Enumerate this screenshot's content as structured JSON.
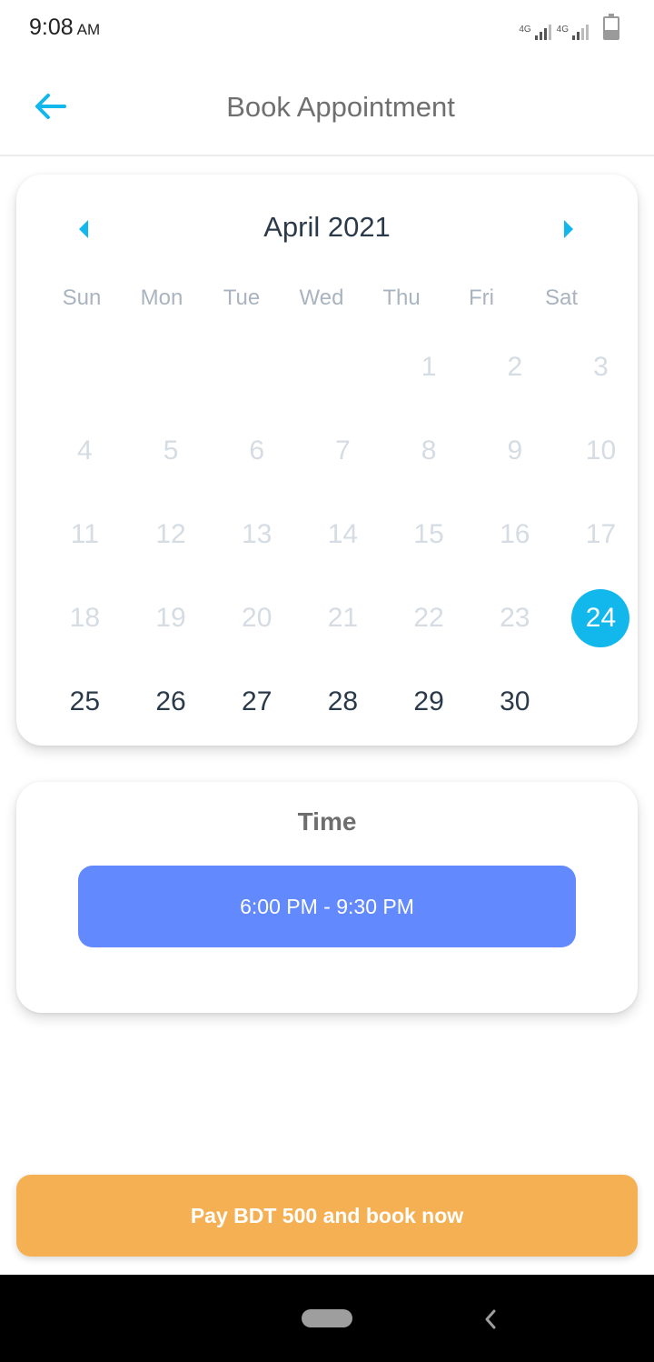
{
  "status_bar": {
    "time": "9:08",
    "ampm": "AM",
    "network_1": "4G",
    "network_2": "4G"
  },
  "app_bar": {
    "title": "Book Appointment",
    "back_icon": "arrow-left-icon",
    "accent_color": "#12b8ec"
  },
  "calendar": {
    "month_label": "April 2021",
    "prev_icon": "caret-left-icon",
    "next_icon": "caret-right-icon",
    "weekdays": [
      "Sun",
      "Mon",
      "Tue",
      "Wed",
      "Thu",
      "Fri",
      "Sat"
    ],
    "days": [
      {
        "label": "",
        "state": "empty"
      },
      {
        "label": "",
        "state": "empty"
      },
      {
        "label": "",
        "state": "empty"
      },
      {
        "label": "",
        "state": "empty"
      },
      {
        "label": "1",
        "state": "disabled"
      },
      {
        "label": "2",
        "state": "disabled"
      },
      {
        "label": "3",
        "state": "disabled"
      },
      {
        "label": "4",
        "state": "disabled"
      },
      {
        "label": "5",
        "state": "disabled"
      },
      {
        "label": "6",
        "state": "disabled"
      },
      {
        "label": "7",
        "state": "disabled"
      },
      {
        "label": "8",
        "state": "disabled"
      },
      {
        "label": "9",
        "state": "disabled"
      },
      {
        "label": "10",
        "state": "disabled"
      },
      {
        "label": "11",
        "state": "disabled"
      },
      {
        "label": "12",
        "state": "disabled"
      },
      {
        "label": "13",
        "state": "disabled"
      },
      {
        "label": "14",
        "state": "disabled"
      },
      {
        "label": "15",
        "state": "disabled"
      },
      {
        "label": "16",
        "state": "disabled"
      },
      {
        "label": "17",
        "state": "disabled"
      },
      {
        "label": "18",
        "state": "disabled"
      },
      {
        "label": "19",
        "state": "disabled"
      },
      {
        "label": "20",
        "state": "disabled"
      },
      {
        "label": "21",
        "state": "disabled"
      },
      {
        "label": "22",
        "state": "disabled"
      },
      {
        "label": "23",
        "state": "disabled"
      },
      {
        "label": "24",
        "state": "selected"
      },
      {
        "label": "25",
        "state": "available"
      },
      {
        "label": "26",
        "state": "available"
      },
      {
        "label": "27",
        "state": "available"
      },
      {
        "label": "28",
        "state": "available"
      },
      {
        "label": "29",
        "state": "available"
      },
      {
        "label": "30",
        "state": "available"
      }
    ],
    "selected_color": "#12b8ec"
  },
  "time_section": {
    "title": "Time",
    "slots": [
      "6:00 PM - 9:30 PM"
    ],
    "slot_color": "#6289fe"
  },
  "pay_button": {
    "label": "Pay BDT 500 and book now",
    "color": "#f5b054"
  },
  "system_nav": {
    "home_icon": "home-pill-icon",
    "back_icon": "system-back-icon"
  }
}
